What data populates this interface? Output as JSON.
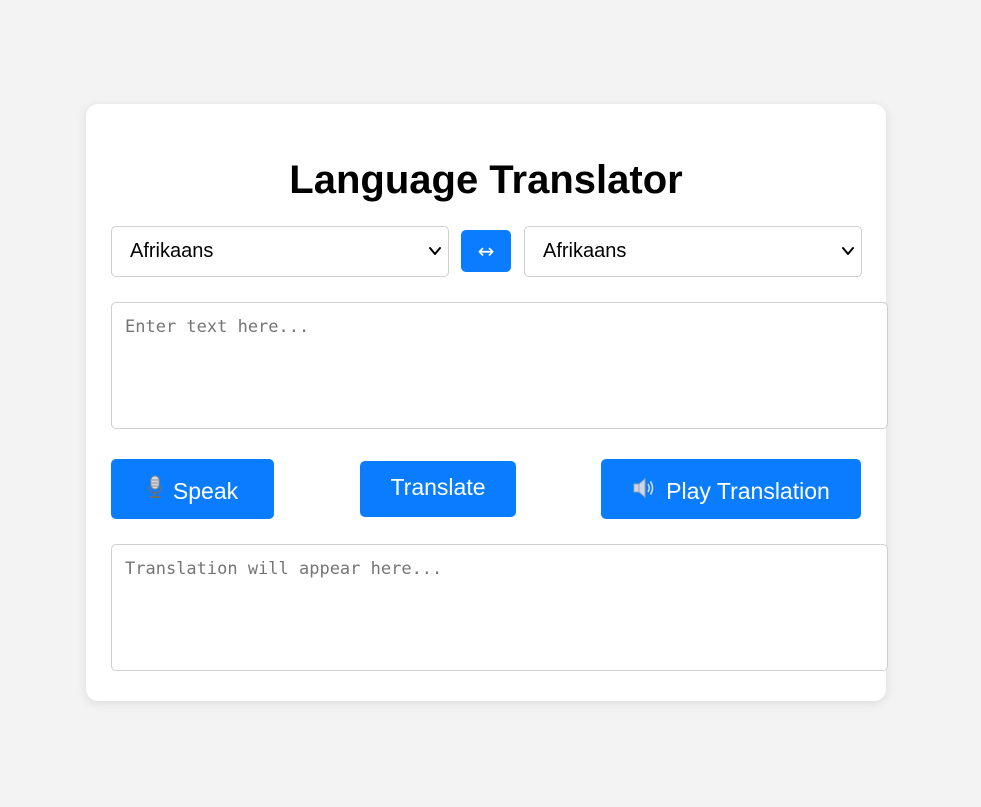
{
  "app": {
    "title": "Language Translator"
  },
  "languages": {
    "source_selected": "Afrikaans",
    "target_selected": "Afrikaans",
    "swap_label": "↔"
  },
  "input": {
    "placeholder": "Enter text here...",
    "value": ""
  },
  "buttons": {
    "speak_label": "Speak",
    "speak_icon": "microphone-icon",
    "translate_label": "Translate",
    "play_label": "Play Translation",
    "play_icon": "speaker-icon"
  },
  "output": {
    "placeholder": "Translation will appear here...",
    "value": ""
  },
  "colors": {
    "accent": "#0a7cff",
    "background": "#f3f3f3",
    "card": "#ffffff"
  }
}
